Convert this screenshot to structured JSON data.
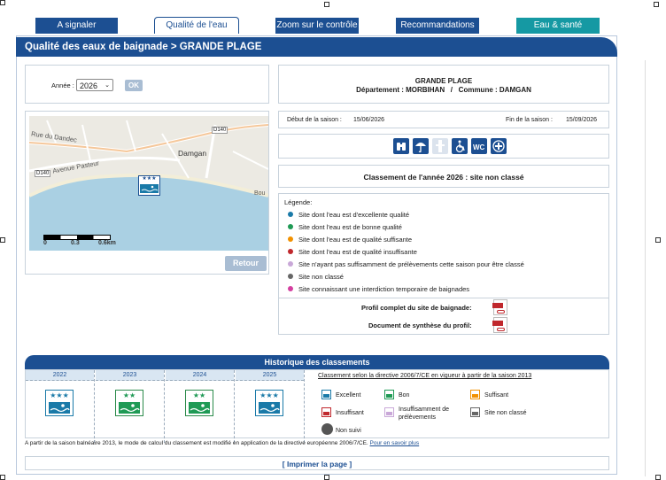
{
  "tabs": [
    {
      "label": "A signaler",
      "style": "dark"
    },
    {
      "label": "Qualité de l'eau",
      "style": "active"
    },
    {
      "label": "Zoom sur le contrôle",
      "style": "dark"
    },
    {
      "label": "Recommandations",
      "style": "dark"
    },
    {
      "label": "Eau & santé",
      "style": "teal"
    }
  ],
  "header": {
    "title": "Qualité des eaux de baignade > GRANDE PLAGE"
  },
  "year_select": {
    "label": "Année :",
    "value": "2026",
    "ok_label": "OK"
  },
  "site": {
    "name": "GRANDE PLAGE",
    "location": "Département : MORBIHAN   /   Commune : DAMGAN"
  },
  "season": {
    "start_label": "Début de la saison :",
    "start_value": "15/06/2026",
    "end_label": "Fin de la saison :",
    "end_value": "15/09/2026"
  },
  "facility_icons": [
    "binoculars-icon",
    "parasol-icon",
    "lifeguard-icon",
    "wheelchair-icon",
    "wc-icon",
    "first-aid-icon"
  ],
  "map": {
    "labels": {
      "rue": "Rue du Dandec",
      "avenue": "Avenue Pasteur",
      "town": "Damgan",
      "road1": "D140",
      "road2": "D140",
      "bou": "Bou",
      "scale0": "0",
      "scale1": "0.3",
      "scale2": "0.6km"
    },
    "back_button": "Retour"
  },
  "classement": {
    "text": "Classement de l'année 2026 : site non classé"
  },
  "legend": {
    "title": "Légende:",
    "items": [
      {
        "label": "Site dont l'eau est d'excellente qualité",
        "color": "#1a7aa8"
      },
      {
        "label": "Site dont l'eau est de bonne qualité",
        "color": "#1f9a55"
      },
      {
        "label": "Site dont l'eau est de qualité suffisante",
        "color": "#f29100"
      },
      {
        "label": "Site dont l'eau est de qualité insuffisante",
        "color": "#c0282d"
      },
      {
        "label": "Site n'ayant pas suffisamment de prélèvements cette saison pour être classé",
        "color": "#c9a8d8"
      },
      {
        "label": "Site non classé",
        "color": "#666666"
      },
      {
        "label": "Site connaissant une interdiction temporaire de baignades",
        "color": "#d43fa0"
      }
    ]
  },
  "profile": {
    "full_label": "Profil complet du site de baignade:",
    "summary_label": "Document de synthèse du profil:"
  },
  "history": {
    "title": "Historique des classements",
    "years": [
      {
        "year": "2022",
        "stars": "★★★"
      },
      {
        "year": "2023",
        "stars": "★★"
      },
      {
        "year": "2024",
        "stars": "★★"
      },
      {
        "year": "2025",
        "stars": "★★★"
      }
    ],
    "directive_title": "Classement selon la directive 2006/7/CE en vigueur à partir de la saison 2013",
    "items": [
      {
        "label": "Excellent"
      },
      {
        "label": "Bon"
      },
      {
        "label": "Suffisant"
      },
      {
        "label": "Insuffisant"
      },
      {
        "label": "Insuffisamment de prélèvements"
      },
      {
        "label": "Site non classé"
      },
      {
        "label": "Non suivi"
      }
    ],
    "footnote": "A partir de la saison balnéaire 2013, le mode de calcul du classement est modifié en application de la directive européenne 2006/7/CE.",
    "footnote_link": "Pour en savoir plus"
  },
  "print": {
    "label": "[ Imprimer la page ]"
  }
}
